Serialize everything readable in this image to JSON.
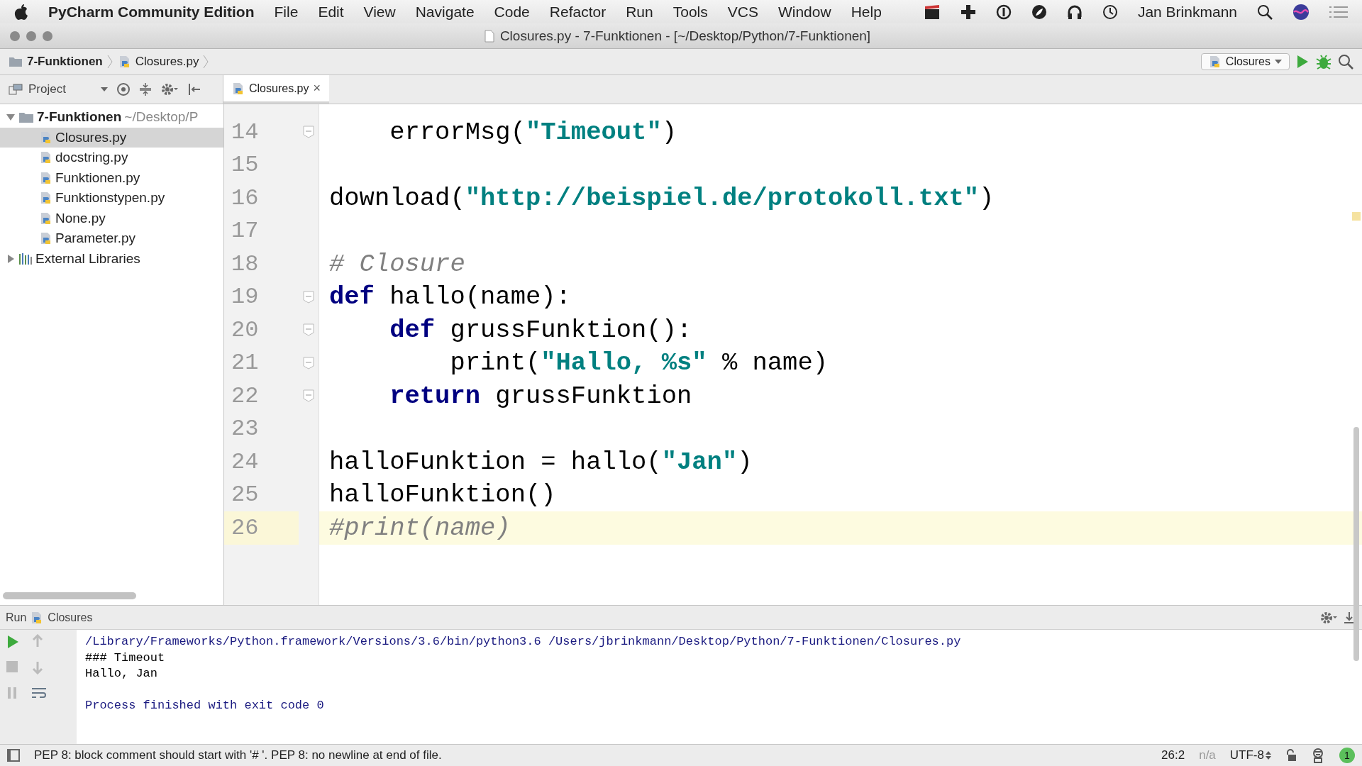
{
  "menu_bar": {
    "app_name": "PyCharm Community Edition",
    "menus": [
      "File",
      "Edit",
      "View",
      "Navigate",
      "Code",
      "Refactor",
      "Run",
      "Tools",
      "VCS",
      "Window",
      "Help"
    ],
    "user": "Jan Brinkmann"
  },
  "window": {
    "title": "Closures.py - 7-Funktionen - [~/Desktop/Python/7-Funktionen]"
  },
  "breadcrumbs": [
    "7-Funktionen",
    "Closures.py"
  ],
  "run_config": "Closures",
  "project_panel": {
    "title": "Project",
    "tree": [
      {
        "label": "7-Funktionen",
        "path": "~/Desktop/P",
        "kind": "folder",
        "expanded": true,
        "selected": false,
        "children": [
          {
            "label": "Closures.py",
            "kind": "file",
            "selected": true
          },
          {
            "label": "docstring.py",
            "kind": "file",
            "selected": false
          },
          {
            "label": "Funktionen.py",
            "kind": "file",
            "selected": false
          },
          {
            "label": "Funktionstypen.py",
            "kind": "file",
            "selected": false
          },
          {
            "label": "None.py",
            "kind": "file",
            "selected": false
          },
          {
            "label": "Parameter.py",
            "kind": "file",
            "selected": false
          }
        ]
      },
      {
        "label": "External Libraries",
        "kind": "library",
        "expanded": false,
        "selected": false
      }
    ]
  },
  "tabs": [
    {
      "label": "Closures.py",
      "close": "×",
      "selected": true
    }
  ],
  "editor": {
    "lines": [
      {
        "number": "14",
        "fold": true,
        "current": false,
        "tokens": [
          {
            "kind": "plain",
            "text": "    errorMsg("
          },
          {
            "kind": "string",
            "text": "\"Timeout\""
          },
          {
            "kind": "plain",
            "text": ")"
          }
        ]
      },
      {
        "number": "15",
        "fold": false,
        "current": false
      },
      {
        "number": "16",
        "fold": false,
        "current": false,
        "tokens": [
          {
            "kind": "plain",
            "text": "download("
          },
          {
            "kind": "string",
            "text": "\"http://beispiel.de/protokoll.txt\""
          },
          {
            "kind": "plain",
            "text": ")"
          }
        ]
      },
      {
        "number": "17",
        "fold": false,
        "current": false
      },
      {
        "number": "18",
        "fold": false,
        "current": false,
        "tokens": [
          {
            "kind": "comment",
            "text": "# Closure"
          }
        ]
      },
      {
        "number": "19",
        "fold": true,
        "current": false,
        "tokens": [
          {
            "kind": "keyword",
            "text": "def"
          },
          {
            "kind": "plain",
            "text": " hallo(name):"
          }
        ]
      },
      {
        "number": "20",
        "fold": true,
        "current": false,
        "tokens": [
          {
            "kind": "keyword",
            "text": "    def"
          },
          {
            "kind": "plain",
            "text": " grussFunktion():"
          }
        ]
      },
      {
        "number": "21",
        "fold": true,
        "current": false,
        "tokens": [
          {
            "kind": "plain",
            "text": "        print("
          },
          {
            "kind": "string",
            "text": "\"Hallo, %s\""
          },
          {
            "kind": "plain",
            "text": " % name)"
          }
        ]
      },
      {
        "number": "22",
        "fold": true,
        "current": false,
        "tokens": [
          {
            "kind": "keyword",
            "text": "    return"
          },
          {
            "kind": "plain",
            "text": " grussFunktion"
          }
        ]
      },
      {
        "number": "23",
        "fold": false,
        "current": false
      },
      {
        "number": "24",
        "fold": false,
        "current": false,
        "tokens": [
          {
            "kind": "plain",
            "text": "halloFunktion = hallo("
          },
          {
            "kind": "string",
            "text": "\"Jan\""
          },
          {
            "kind": "plain",
            "text": ")"
          }
        ]
      },
      {
        "number": "25",
        "fold": false,
        "current": false,
        "tokens": [
          {
            "kind": "plain",
            "text": "halloFunktion()"
          }
        ]
      },
      {
        "number": "26",
        "fold": false,
        "current": true,
        "tokens": [
          {
            "kind": "comment",
            "text": "#print(name)"
          }
        ]
      }
    ]
  },
  "run_panel": {
    "title": "Run",
    "config": "Closures",
    "output": [
      {
        "kind": "command",
        "text": "/Library/Frameworks/Python.framework/Versions/3.6/bin/python3.6 /Users/jbrinkmann/Desktop/Python/7-Funktionen/Closures.py"
      },
      {
        "kind": "stdout",
        "text": "### Timeout"
      },
      {
        "kind": "stdout",
        "text": "Hallo, Jan"
      },
      {
        "kind": "blank"
      },
      {
        "kind": "system",
        "text": "Process finished with exit code 0"
      }
    ]
  },
  "status_bar": {
    "message": "PEP 8: block comment should start with '# '. PEP 8: no newline at end of file.",
    "position": "26:2",
    "vcs": "n/a",
    "encoding": "UTF-8",
    "notifications": "1"
  }
}
